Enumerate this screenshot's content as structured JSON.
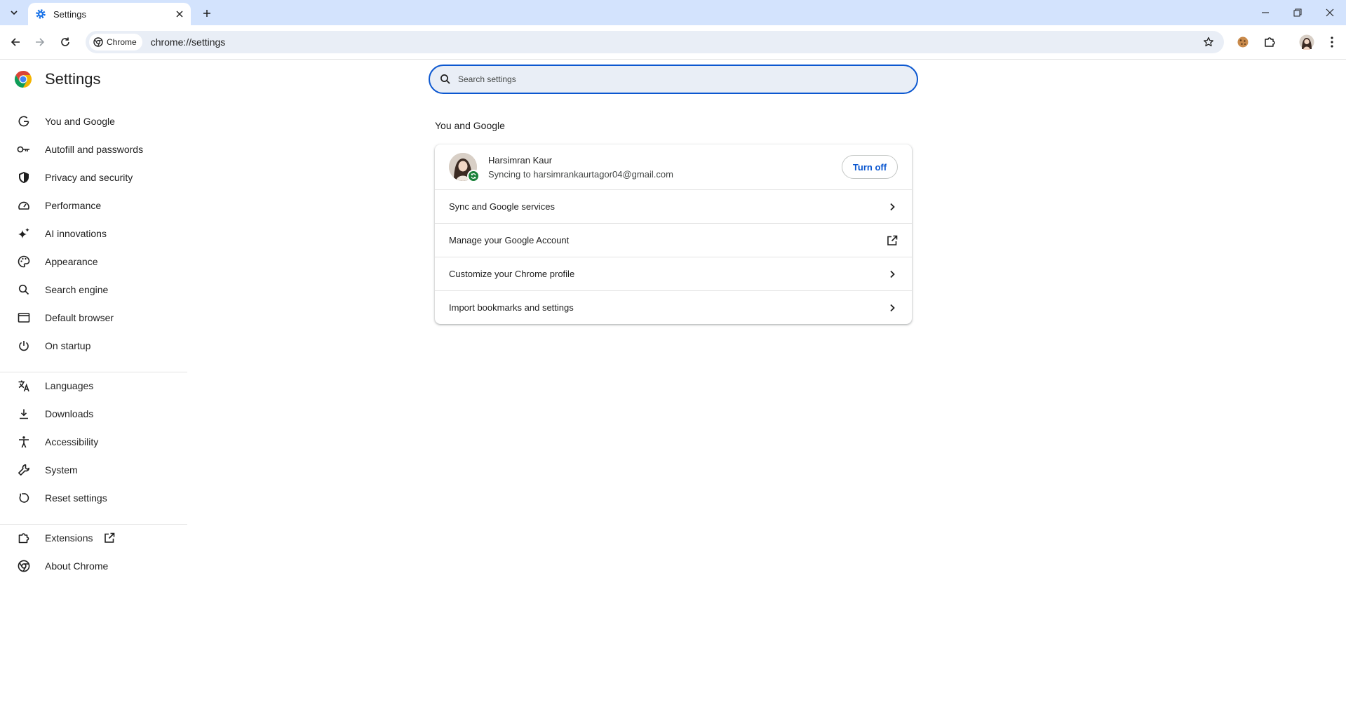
{
  "browser": {
    "tab_title": "Settings",
    "chip_label": "Chrome",
    "url": "chrome://settings"
  },
  "sidebar": {
    "title": "Settings",
    "groups": [
      [
        {
          "label": "You and Google",
          "icon": "google-g-icon"
        },
        {
          "label": "Autofill and passwords",
          "icon": "key-icon"
        },
        {
          "label": "Privacy and security",
          "icon": "shield-icon"
        },
        {
          "label": "Performance",
          "icon": "speedometer-icon"
        },
        {
          "label": "AI innovations",
          "icon": "sparkle-icon"
        },
        {
          "label": "Appearance",
          "icon": "palette-icon"
        },
        {
          "label": "Search engine",
          "icon": "search-icon"
        },
        {
          "label": "Default browser",
          "icon": "browser-window-icon"
        },
        {
          "label": "On startup",
          "icon": "power-icon"
        }
      ],
      [
        {
          "label": "Languages",
          "icon": "translate-icon"
        },
        {
          "label": "Downloads",
          "icon": "download-icon"
        },
        {
          "label": "Accessibility",
          "icon": "accessibility-icon"
        },
        {
          "label": "System",
          "icon": "wrench-icon"
        },
        {
          "label": "Reset settings",
          "icon": "reset-icon"
        }
      ],
      [
        {
          "label": "Extensions",
          "icon": "puzzle-icon"
        },
        {
          "label": "About Chrome",
          "icon": "chrome-icon"
        }
      ]
    ]
  },
  "search": {
    "placeholder": "Search settings"
  },
  "main": {
    "section_title": "You and Google",
    "profile": {
      "name": "Harsimran Kaur",
      "sync_status": "Syncing to harsimrankaurtagor04@gmail.com",
      "turn_off_label": "Turn off"
    },
    "rows": [
      {
        "label": "Sync and Google services",
        "icon": "chevron-right-icon"
      },
      {
        "label": "Manage your Google Account",
        "icon": "open-in-new-icon"
      },
      {
        "label": "Customize your Chrome profile",
        "icon": "chevron-right-icon"
      },
      {
        "label": "Import bookmarks and settings",
        "icon": "chevron-right-icon"
      }
    ]
  },
  "colors": {
    "accent": "#0b57d0",
    "tabstrip": "#d3e3fd",
    "omnibox": "#e9eef6",
    "sync_badge": "#188038"
  }
}
